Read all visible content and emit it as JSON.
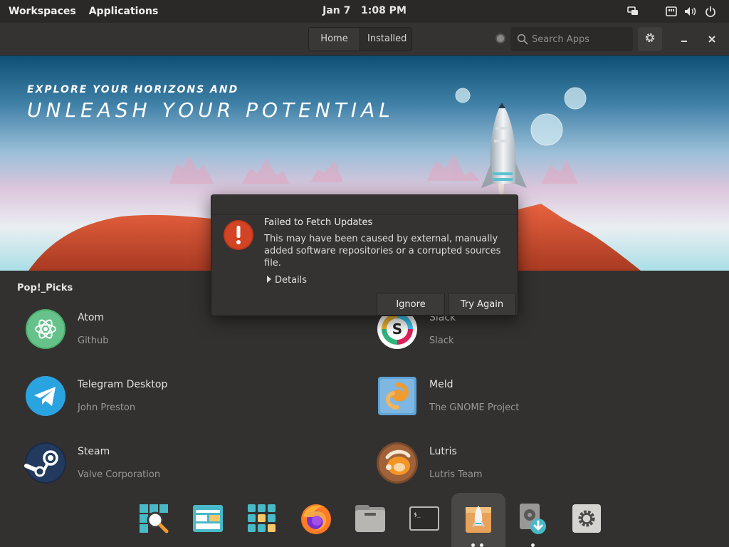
{
  "panel": {
    "workspaces": "Workspaces",
    "applications": "Applications",
    "date": "Jan 7",
    "time": "1:08 PM"
  },
  "header": {
    "tabs": [
      {
        "label": "Home",
        "active": false
      },
      {
        "label": "Installed",
        "active": true
      }
    ],
    "search_placeholder": "Search Apps"
  },
  "banner": {
    "line1": "EXPLORE YOUR HORIZONS AND",
    "line2": "UNLEASH YOUR POTENTIAL"
  },
  "picks": {
    "title": "Pop!_Picks",
    "apps": [
      {
        "name": "Atom",
        "developer": "Github",
        "icon": "atom-icon"
      },
      {
        "name": "Slack",
        "developer": "Slack",
        "icon": "slack-icon"
      },
      {
        "name": "Telegram Desktop",
        "developer": "John Preston",
        "icon": "telegram-icon"
      },
      {
        "name": "Meld",
        "developer": "The GNOME Project",
        "icon": "meld-icon"
      },
      {
        "name": "Steam",
        "developer": "Valve Corporation",
        "icon": "steam-icon"
      },
      {
        "name": "Lutris",
        "developer": "Lutris Team",
        "icon": "lutris-icon"
      }
    ]
  },
  "dialog": {
    "title": "Failed to Fetch Updates",
    "body": "This may have been caused by external, manually added software repositories or a corrupted sources file.",
    "details": "Details",
    "ignore": "Ignore",
    "try_again": "Try Again"
  },
  "dock": {
    "items": [
      "search-icon",
      "web-browser-layout-icon",
      "app-grid-icon",
      "firefox-icon",
      "files-icon",
      "terminal-icon",
      "pop-shop-icon",
      "installer-icon",
      "settings-icon"
    ]
  },
  "colors": {
    "accent": "#48b9c7",
    "error": "#c5381b",
    "background": "#333130"
  }
}
